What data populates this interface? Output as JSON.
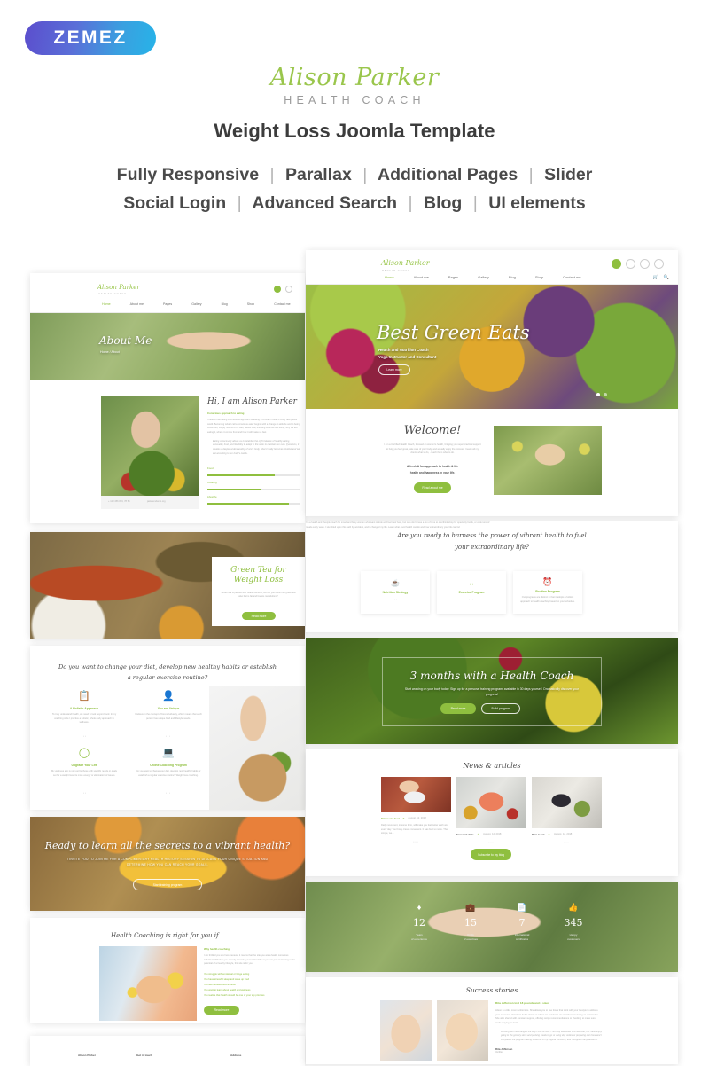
{
  "vendor": {
    "logo_text": "ZEMEZ",
    "logo_gradient_from": "#5b4ecd",
    "logo_gradient_to": "#27b3e8"
  },
  "header": {
    "brand_name": "Alison Parker",
    "brand_tagline": "HEALTH COACH",
    "product_title": "Weight Loss Joomla Template",
    "brand_color": "#9ac64c"
  },
  "features": {
    "row1": [
      "Fully Responsive",
      "Parallax",
      "Additional Pages",
      "Slider"
    ],
    "row2": [
      "Social Login",
      "Advanced Search",
      "Blog",
      "UI elements"
    ],
    "separator": "|"
  },
  "site": {
    "brand": "Alison Parker",
    "brand_sub": "HEALTH COACH",
    "nav": [
      "Home",
      "About me",
      "Pages",
      "Gallery",
      "Blog",
      "Shop",
      "Contact me"
    ]
  },
  "screens": {
    "about": {
      "hero_title": "About Me",
      "breadcrumb": "Home / About",
      "heading": "Hi, I am Alison Parker",
      "subheading": "Conscious approach to eating",
      "paragraph": "I believe that taking a conscious approach to eating is crucial in today's crazy fast-paced world. Becoming what I call a conscious eater begins with a change in attitude and in being conscious, simply means to be well, aware now, knowing what we are doing, why we are eating it, where it comes from and how it will make us feel.",
      "quote": "Eating consciously allows us to establish the right balance of healthy eating, sensuality, food, and flexibility to adapt to the outer to maintain our own. Questions, it creates a deeper understanding of one's body, what it really becomes intuitive and we eat according to our body's needs.",
      "skills": [
        {
          "label": "Food",
          "value": 72
        },
        {
          "label": "Cooking",
          "value": 58
        },
        {
          "label": "Lifestyle",
          "value": 88
        }
      ],
      "phone": "+ 123 456 889, 78 56",
      "email": "jaskeemdemo.org"
    },
    "green_tea": {
      "title_line1": "Green Tea for",
      "title_line2": "Weight Loss",
      "text": "Green tea is packed with health benefits, but did you know that green tea also burns fat and boosts metabolism?",
      "button": "Read more"
    },
    "habits": {
      "title_line1": "Do you want to change your diet, develop new healthy habits or establish",
      "title_line2": "a regular exercise routine?",
      "cards": [
        {
          "title": "A Holistic Approach",
          "text": "To truly understand health, we need to look beyond food. In my coaching style I practice a holistic, whole-body approach to wellness."
        },
        {
          "title": "You are Unique",
          "text": "I believe in the concept of bio-individuality, which means that each person has unique food and lifestyle needs."
        },
        {
          "title": "Upgrade Your Life",
          "text": "My wellness aim is not just for those with specific needs or goals out for a weight loss, its more energy or elimination of issues."
        },
        {
          "title": "Online Coaching Program",
          "text": "Do you want to change your diet, develop new healthy habits or establish a regular exercise routine? Weight loss coaching."
        }
      ]
    },
    "vibrant": {
      "title": "Ready to learn all the secrets to a vibrant health?",
      "sub": "I INVITE YOU TO JOIN ME FOR A COMPLIMENTARY HEALTH HISTORY SESSION TO DISCUSS YOUR UNIQUE SITUATION AND DETERMINE HOW YOU CAN REACH YOUR GOALS.",
      "button": "Start training program"
    },
    "coaching_right": {
      "title": "Health Coaching is right for you if...",
      "subtitle": "Why health coaching",
      "paragraph": "I am thrilled you are here because it means that the site you are a health conscious individual. Whether you already consider yourself healthy or you are just awakening to the potential of a healthy lifestyle, this site is for you.",
      "bullets": [
        "You struggle with emotional or binge eating",
        "You have stressful sleep and wake up tired",
        "You feel stressed and anxious",
        "You want to learn about health and wellness",
        "You realize that health should be one of your top priorities"
      ],
      "button": "Read more"
    },
    "footer": {
      "columns": [
        "Alison Parker",
        "Get in touch",
        "Address"
      ]
    },
    "home": {
      "hero_title": "Best Green Eats",
      "hero_sub_line1": "Health and Nutrition Coach",
      "hero_sub_line2": "Yoga Instructor and Consultant",
      "hero_button": "Learn more",
      "welcome_title": "Welcome!",
      "welcome_text": "I am a Certified Health Coach, focused on women's health, bringing you super practical support to help you feel great, take care of your body, and actually enjoy the process. I teach all my clients what to do, - teach them what to do.",
      "welcome_highlight_line1": "A fresh & fun approach to health & life",
      "welcome_highlight_line2": "health and happiness in your life.",
      "welcome_button": "Read about me"
    },
    "services": {
      "title_line1": "Are you ready to harness the power of vibrant health to fuel",
      "title_line2": "your extraordinary life?",
      "intro": "I'm a health and lifestyle coach for smart and busy women who want to look and feel their best, but who don't have a ton of time to overthink shop for speciality foods, or cook tons of meals every week. I stumbled upon this path by accident, and it changed my life. Learn what good health can do and how extraordinary your life can be!",
      "cards": [
        {
          "title": "Nutrition Strategy",
          "icon": "mortar-icon"
        },
        {
          "title": "Exercise Program",
          "icon": "dumbbell-icon"
        },
        {
          "title": "Routine Program",
          "icon": "clock-icon",
          "text": "Our programs are distinct in that it adopts a holistic approach to health coaching based on your schedule."
        }
      ]
    },
    "months": {
      "title": "3 months with a Health Coach",
      "sub": "Start working on your body today. Sign up for a personal training program, available in 30 days yourself. Dramatically discover your progress!",
      "button_primary": "Read more",
      "button_secondary": "Build program"
    },
    "news": {
      "title": "News & articles",
      "subscribe_button": "Subscribe to my blog",
      "posts": [
        {
          "category": "Dinner and food",
          "date": "August, 12, 2018",
          "excerpt": "Daily movement, in some form, will make you feel better each and every day. Your body craves movement. It was built to move. That simple, we..."
        },
        {
          "category": "Seasonal diets",
          "date": "August, 12, 2018"
        },
        {
          "category": "Pure to eat",
          "date": "August, 12, 2018"
        }
      ]
    },
    "stats": [
      {
        "value": "12",
        "label_line1": "Years",
        "label_line2": "of experience",
        "icon": "diamond-icon"
      },
      {
        "value": "15",
        "label_line1": "Kinds",
        "label_line2": "of exercises",
        "icon": "briefcase-icon"
      },
      {
        "value": "7",
        "label_line1": "International",
        "label_line2": "certificates",
        "icon": "certificate-icon"
      },
      {
        "value": "345",
        "label_line1": "Happy",
        "label_line2": "customers",
        "icon": "thumbs-up-icon"
      }
    ],
    "success": {
      "title": "Success stories",
      "story_title": "Rita Jefferson lost 18 pounds and 3 sizes",
      "paragraph": "Alison is unlike most nutritionists. She allows you to use foods that work with your lifestyle to address your concerns. I felt that I had a choice in what I ate and how I ate in rather than being on a strict diet. She also shared with constant support, offering recipe recommendations or checking to make sure I made staying on track.",
      "quote": "Working with her changed the way I look at food. I not only feel better and healthier, but I also enjoy going to the grocery store and packing meals to go or using dog orders or preparing own food and I completed the program having flexed all of my original concerns, and I dropped many sessions.",
      "author": "Rita Jefferson",
      "author_role": "Verified"
    }
  }
}
